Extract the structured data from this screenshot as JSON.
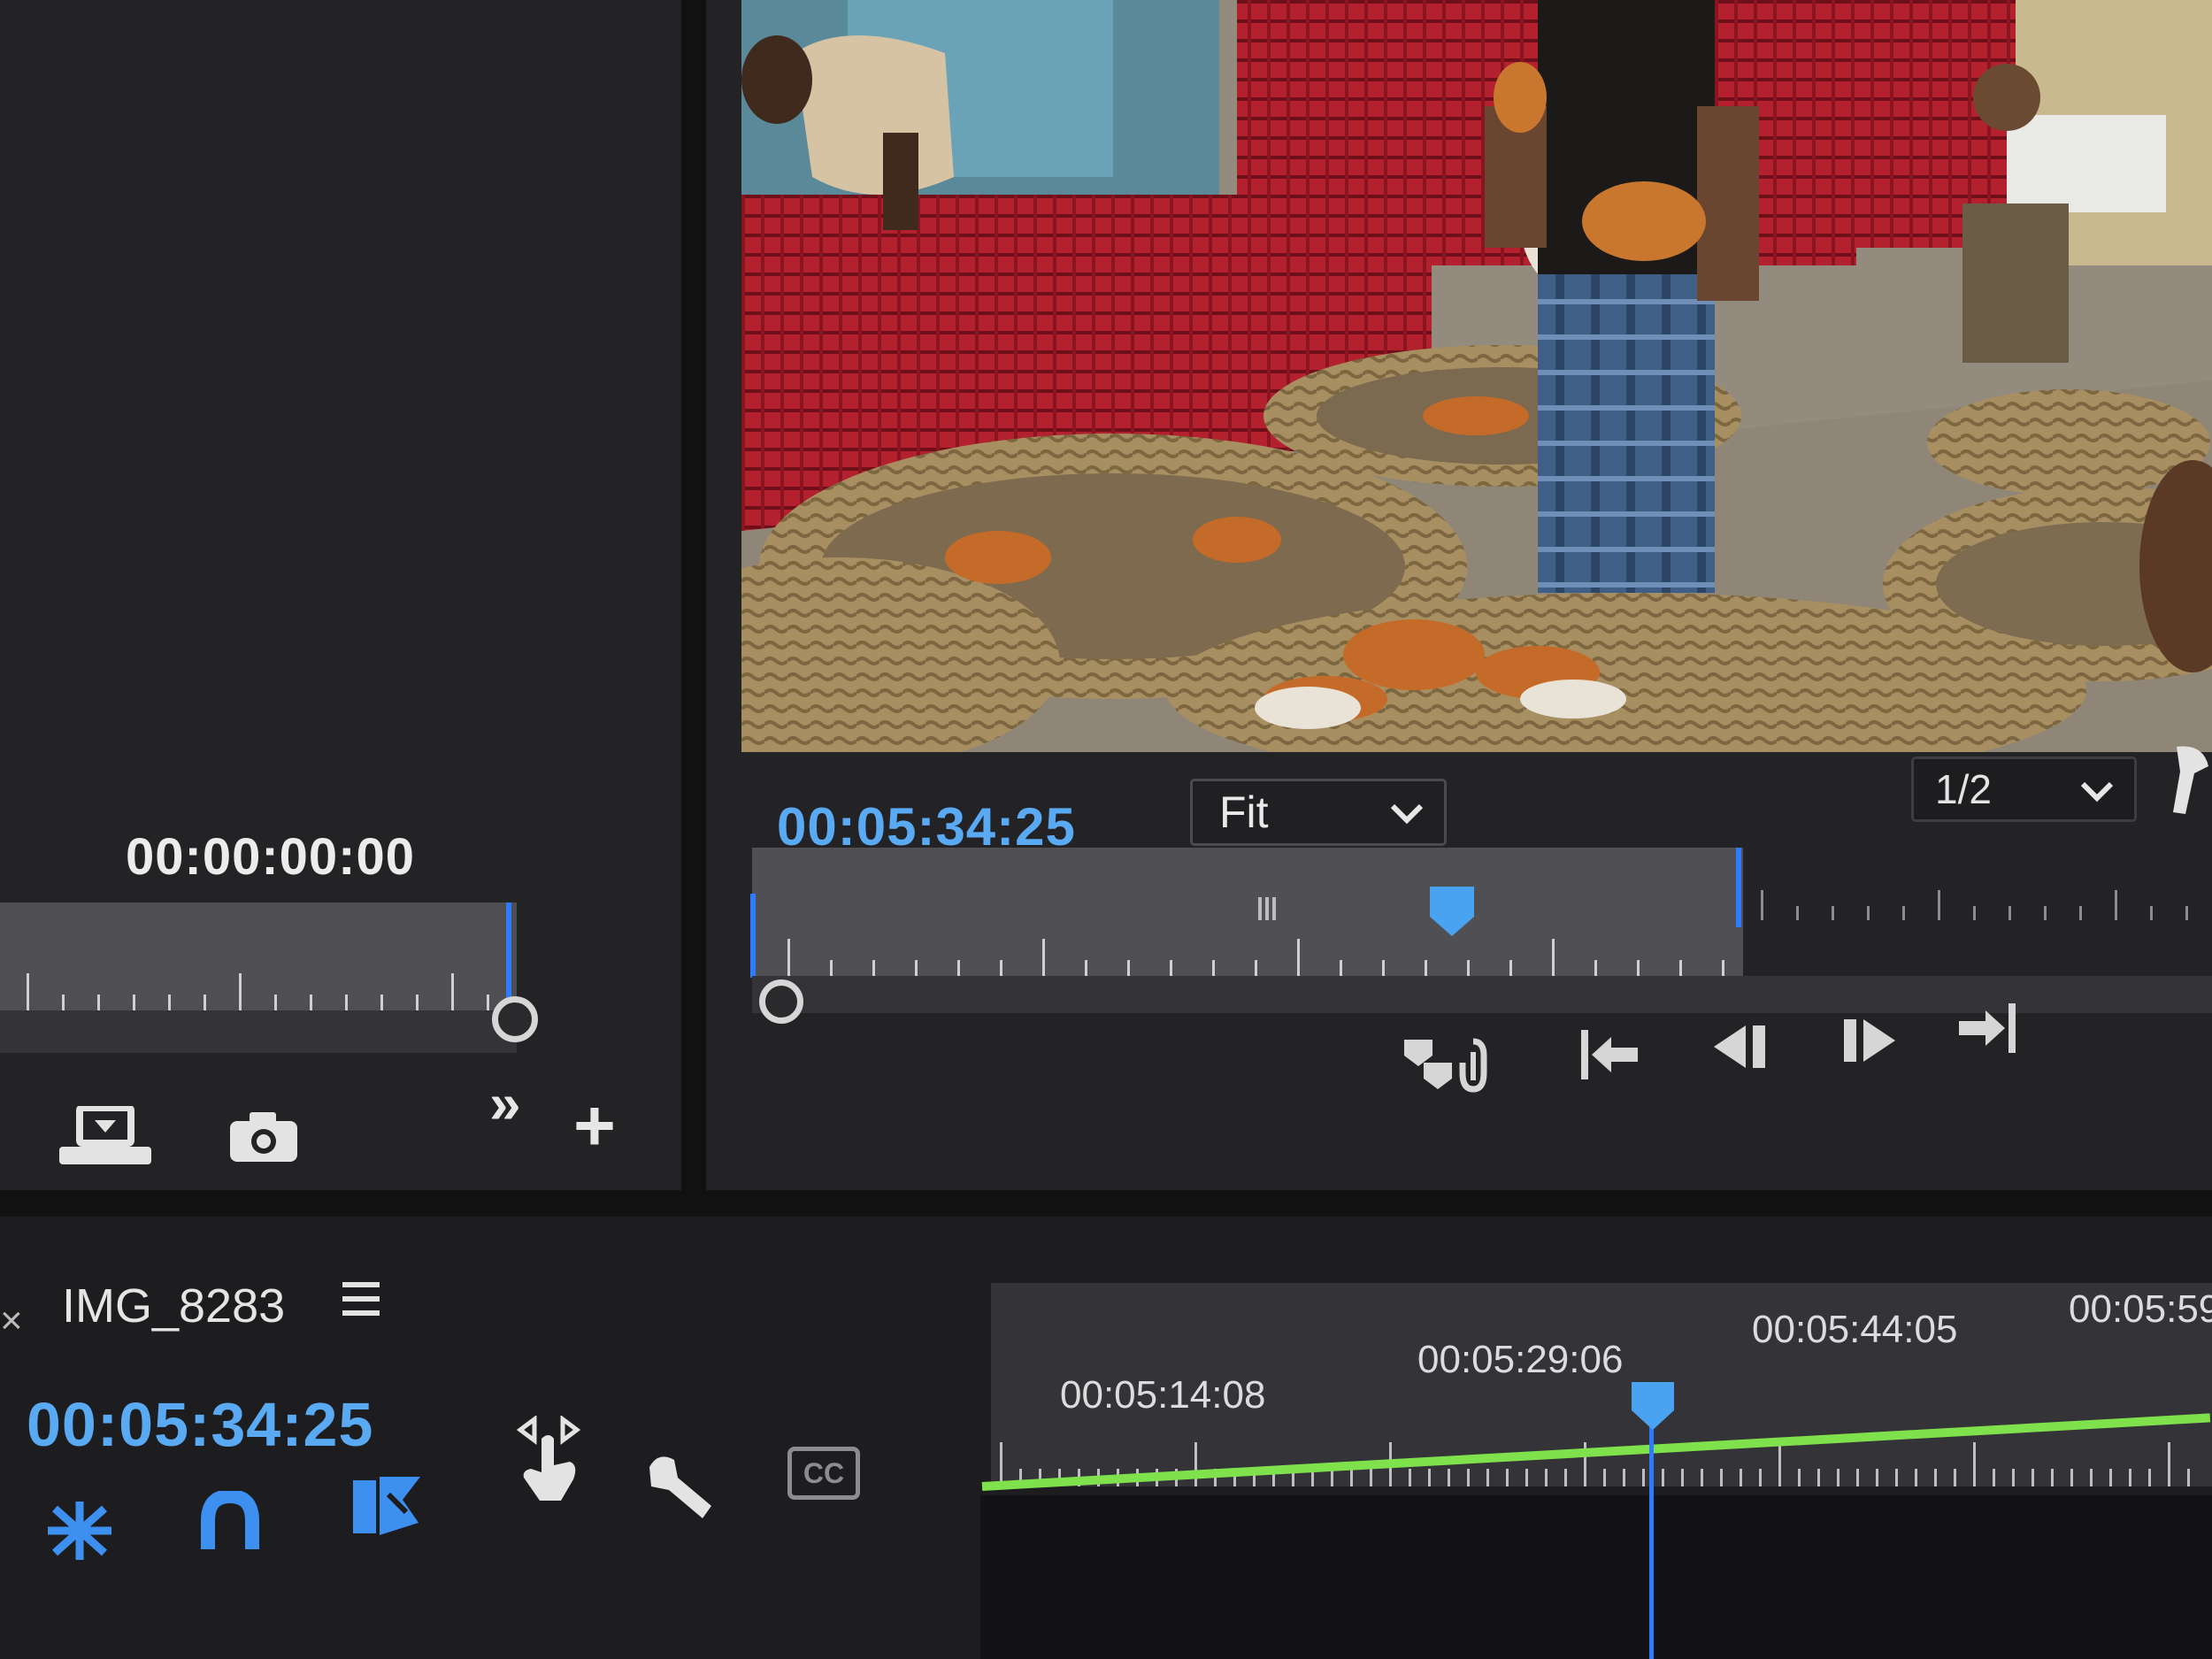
{
  "source_monitor": {
    "timecode": "00:00:00:00",
    "more_label": "»",
    "add_label": "+"
  },
  "program_monitor": {
    "timecode": "00:05:34:25",
    "zoom_select": {
      "value": "Fit"
    },
    "resolution_select": {
      "value": "1/2"
    },
    "playhead_position": 0.7
  },
  "timeline": {
    "close_label": "×",
    "sequence_name": "IMG_8283",
    "timecode": "00:05:34:25",
    "ruler_labels": [
      "00:05:14:08",
      "00:05:29:06",
      "00:05:44:05",
      "00:05:59"
    ],
    "cc_label": "CC"
  },
  "colors": {
    "accent_blue": "#5aa9f3",
    "playhead_blue": "#2d7bff",
    "work_area_green": "#7fe14b",
    "panel_bg": "#232326"
  },
  "icons": {
    "export_frame": "export-frame-icon",
    "camera": "camera-icon",
    "marker": "marker-icon",
    "goto_in": "go-to-in-icon",
    "step_back": "step-back-icon",
    "step_forward": "step-forward-icon",
    "goto_out": "go-to-out-icon",
    "snap": "snap-icon",
    "magnet": "linked-selection-icon",
    "insert": "insert-tool-icon",
    "hand": "hand-icon",
    "wrench": "wrench-icon"
  }
}
